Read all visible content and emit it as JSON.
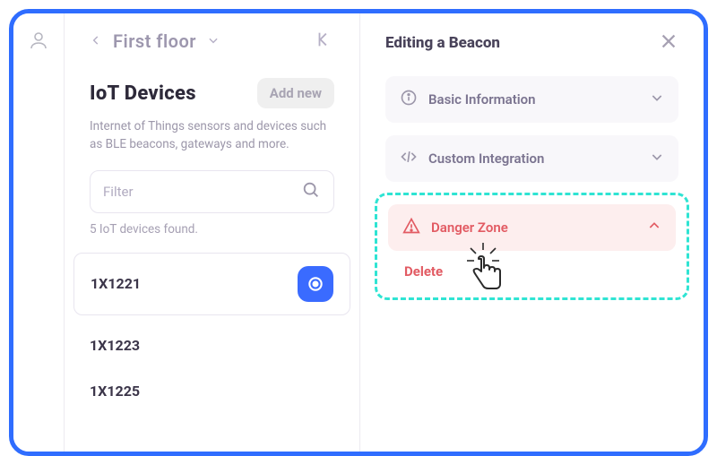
{
  "floor": {
    "title": "First floor"
  },
  "section": {
    "title": "IoT Devices",
    "add_label": "Add new",
    "description": "Internet of Things sensors and devices such as BLE beacons, gateways and more.",
    "filter_placeholder": "Filter",
    "found_text": "5 IoT devices found."
  },
  "devices": {
    "items": [
      {
        "name": "1X1221",
        "selected": true
      },
      {
        "name": "1X1223",
        "selected": false
      },
      {
        "name": "1X1225",
        "selected": false
      }
    ]
  },
  "editor": {
    "title": "Editing a Beacon",
    "sections": {
      "basic": "Basic Information",
      "custom": "Custom Integration",
      "danger": "Danger Zone"
    },
    "delete_label": "Delete"
  }
}
